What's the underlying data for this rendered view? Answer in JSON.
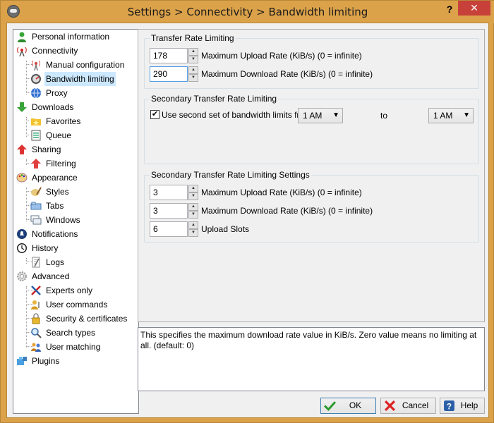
{
  "window": {
    "title": "Settings > Connectivity > Bandwidth limiting",
    "help_glyph": "?",
    "close_glyph": "✕"
  },
  "tree": {
    "items": [
      {
        "label": "Personal information",
        "icon": "person-icon"
      },
      {
        "label": "Connectivity",
        "icon": "antenna-icon"
      },
      {
        "label": "Manual configuration",
        "icon": "signal-icon"
      },
      {
        "label": "Bandwidth limiting",
        "icon": "speedometer-icon",
        "selected": true
      },
      {
        "label": "Proxy",
        "icon": "globe-icon"
      },
      {
        "label": "Downloads",
        "icon": "down-arrow-icon"
      },
      {
        "label": "Favorites",
        "icon": "folder-star-icon"
      },
      {
        "label": "Queue",
        "icon": "queue-icon"
      },
      {
        "label": "Sharing",
        "icon": "up-arrow-icon"
      },
      {
        "label": "Filtering",
        "icon": "filter-icon"
      },
      {
        "label": "Appearance",
        "icon": "palette-icon"
      },
      {
        "label": "Styles",
        "icon": "brush-icon"
      },
      {
        "label": "Tabs",
        "icon": "tabs-icon"
      },
      {
        "label": "Windows",
        "icon": "windows-icon"
      },
      {
        "label": "Notifications",
        "icon": "bell-icon"
      },
      {
        "label": "History",
        "icon": "clock-icon"
      },
      {
        "label": "Logs",
        "icon": "log-icon"
      },
      {
        "label": "Advanced",
        "icon": "gear-icon"
      },
      {
        "label": "Experts only",
        "icon": "tools-icon"
      },
      {
        "label": "User commands",
        "icon": "user-command-icon"
      },
      {
        "label": "Security & certificates",
        "icon": "lock-icon"
      },
      {
        "label": "Search types",
        "icon": "search-icon"
      },
      {
        "label": "User matching",
        "icon": "users-icon"
      },
      {
        "label": "Plugins",
        "icon": "plugin-icon"
      }
    ]
  },
  "transfer": {
    "title": "Transfer Rate Limiting",
    "upload_value": "178",
    "upload_label": "Maximum Upload Rate (KiB/s) (0 = infinite)",
    "download_value": "290",
    "download_label": "Maximum Download Rate (KiB/s) (0 = infinite)"
  },
  "secondary": {
    "title": "Secondary Transfer Rate Limiting",
    "checkbox_label": "Use second set of bandwidth limits from",
    "checked_glyph": "✔",
    "from_value": "1 AM",
    "to_label": "to",
    "to_value": "1 AM"
  },
  "secondary_settings": {
    "title": "Secondary Transfer Rate Limiting Settings",
    "upload_value": "3",
    "upload_label": "Maximum Upload Rate (KiB/s) (0 = infinite)",
    "download_value": "3",
    "download_label": "Maximum Download Rate (KiB/s) (0 = infinite)",
    "slots_value": "6",
    "slots_label": "Upload Slots"
  },
  "description": "This specifies the maximum download rate value in KiB/s. Zero value means no limiting at all. (default: 0)",
  "buttons": {
    "ok": "OK",
    "cancel": "Cancel",
    "help": "Help"
  },
  "glyphs": {
    "up": "▲",
    "down": "▼",
    "chevron": "▼"
  }
}
